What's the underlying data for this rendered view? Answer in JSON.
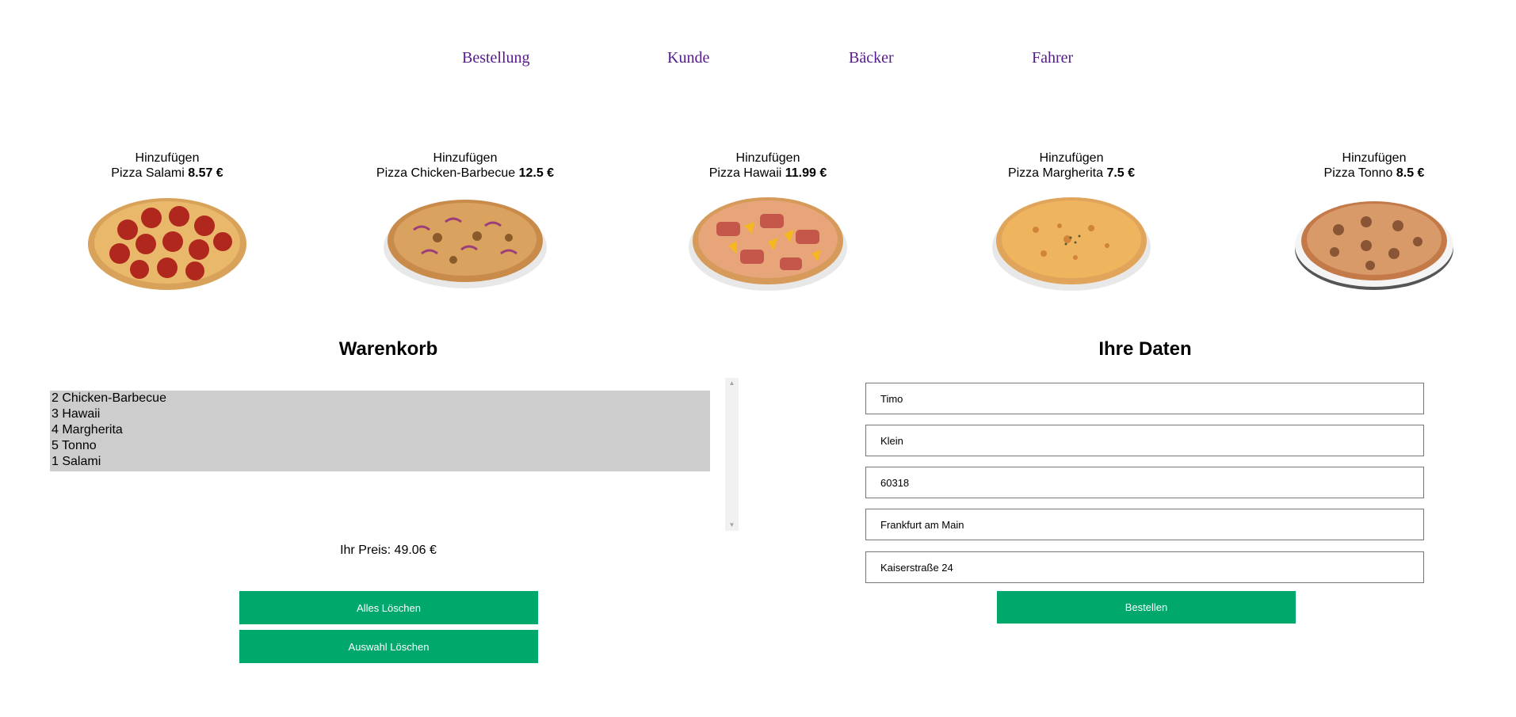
{
  "nav": {
    "items": [
      "Bestellung",
      "Kunde",
      "Bäcker",
      "Fahrer"
    ]
  },
  "pizzas": [
    {
      "add_label": "Hinzufügen",
      "name": "Pizza Salami",
      "price": "8.57 €"
    },
    {
      "add_label": "Hinzufügen",
      "name": "Pizza Chicken-Barbecue",
      "price": "12.5 €"
    },
    {
      "add_label": "Hinzufügen",
      "name": "Pizza Hawaii",
      "price": "11.99 €"
    },
    {
      "add_label": "Hinzufügen",
      "name": "Pizza Margherita",
      "price": "7.5 €"
    },
    {
      "add_label": "Hinzufügen",
      "name": "Pizza Tonno",
      "price": "8.5 €"
    }
  ],
  "cart": {
    "title": "Warenkorb",
    "items": [
      "2 Chicken-Barbecue",
      "3 Hawaii",
      "4 Margherita",
      "5 Tonno",
      "1 Salami"
    ],
    "price_label": "Ihr Preis: 49.06 €",
    "clear_all_label": "Alles Löschen",
    "clear_selection_label": "Auswahl Löschen"
  },
  "customer": {
    "title": "Ihre Daten",
    "first_name": "Timo",
    "last_name": "Klein",
    "zip": "60318",
    "city": "Frankfurt am Main",
    "street": "Kaiserstraße 24",
    "order_label": "Bestellen"
  },
  "colors": {
    "accent": "#00a86b",
    "link": "#551a8b",
    "selection": "#cdcdcd"
  }
}
